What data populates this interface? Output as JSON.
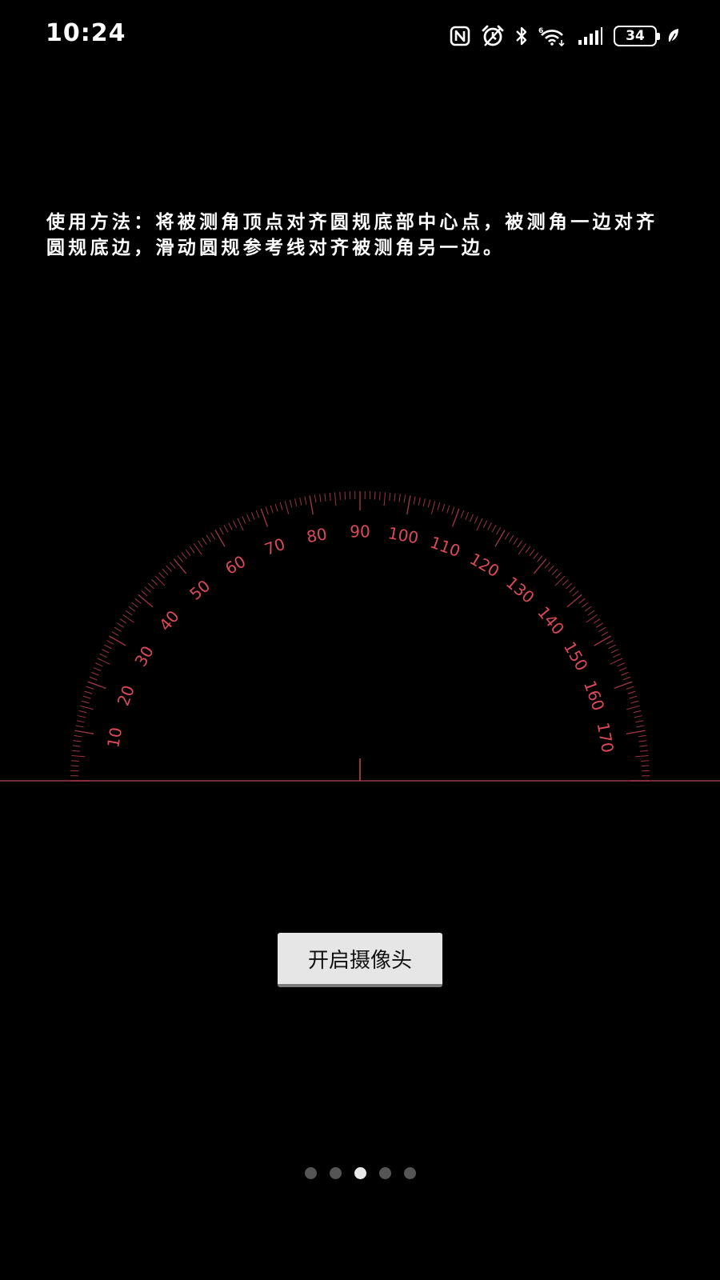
{
  "status_bar": {
    "time": "10:24",
    "battery_level": "34",
    "icons": [
      "nfc-icon",
      "alarm-icon",
      "bluetooth-icon",
      "wifi-6-icon",
      "signal-icon",
      "battery-icon",
      "leaf-icon"
    ]
  },
  "instructions": {
    "text": "使用方法：将被测角顶点对齐圆规底部中心点，被测角一边对齐圆规底边，滑动圆规参考线对齐被测角另一边。"
  },
  "protractor": {
    "labels": [
      "10",
      "20",
      "30",
      "40",
      "50",
      "60",
      "70",
      "80",
      "90",
      "100",
      "110",
      "120",
      "130",
      "140",
      "150",
      "160",
      "170"
    ],
    "color": "#d9495a",
    "range_degrees": [
      0,
      180
    ],
    "reference_angle": 90
  },
  "camera_button": {
    "label": "开启摄像头"
  },
  "pager": {
    "count": 5,
    "active_index": 2
  }
}
